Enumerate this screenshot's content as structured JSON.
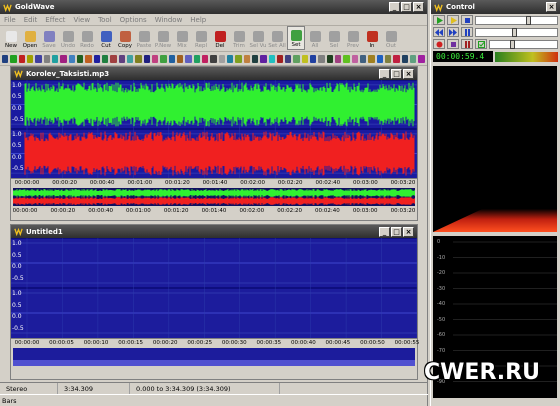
{
  "app": {
    "title": "GoldWave"
  },
  "menu": [
    "File",
    "Edit",
    "Effect",
    "View",
    "Tool",
    "Options",
    "Window",
    "Help"
  ],
  "toolbar": [
    {
      "label": "New",
      "color": "#e8e8e8",
      "on": true
    },
    {
      "label": "Open",
      "color": "#e0b040",
      "on": true
    },
    {
      "label": "Save",
      "color": "#8080c0",
      "on": false
    },
    {
      "label": "Undo",
      "color": "#a0a0a0",
      "on": false
    },
    {
      "label": "Redo",
      "color": "#a0a0a0",
      "on": false
    },
    {
      "label": "Cut",
      "color": "#4060c0",
      "on": true
    },
    {
      "label": "Copy",
      "color": "#c06040",
      "on": true
    },
    {
      "label": "Paste",
      "color": "#a0a0a0",
      "on": false
    },
    {
      "label": "P.New",
      "color": "#a0a0a0",
      "on": false
    },
    {
      "label": "Mix",
      "color": "#a0a0a0",
      "on": false
    },
    {
      "label": "Repl",
      "color": "#a0a0a0",
      "on": false
    },
    {
      "label": "Del",
      "color": "#c02020",
      "on": true
    },
    {
      "label": "Trim",
      "color": "#a0a0a0",
      "on": false
    },
    {
      "label": "Sel Vu",
      "color": "#a0a0a0",
      "on": false
    },
    {
      "label": "Set All",
      "color": "#a0a0a0",
      "on": false
    },
    {
      "label": "Set",
      "color": "#40a040",
      "on": true
    },
    {
      "label": "All",
      "color": "#a0a0a0",
      "on": false
    },
    {
      "label": "Sel",
      "color": "#a0a0a0",
      "on": false
    },
    {
      "label": "Prev",
      "color": "#a0a0a0",
      "on": false
    },
    {
      "label": "In",
      "color": "#c03020",
      "on": true
    },
    {
      "label": "Out",
      "color": "#a0a0a0",
      "on": false
    }
  ],
  "doc1": {
    "title": "Korolev_Taksisti.mp3",
    "yticks_top": [
      "1.0",
      "0.5",
      "0.0",
      "-0.5"
    ],
    "yticks_bot": [
      "1.0",
      "0.5",
      "0.0",
      "-0.5"
    ],
    "time_labels": [
      "00:00:00",
      "00:00:20",
      "00:00:40",
      "00:01:00",
      "00:01:20",
      "00:01:40",
      "00:02:00",
      "00:02:20",
      "00:02:40",
      "00:03:00",
      "00:03:20"
    ],
    "ov_labels": [
      "00:00:00",
      "00:00:20",
      "00:00:40",
      "00:01:00",
      "00:01:20",
      "00:01:40",
      "00:02:00",
      "00:02:20",
      "00:02:40",
      "00:03:00",
      "00:03:20"
    ]
  },
  "doc2": {
    "title": "Untitled1",
    "yticks_top": [
      "1.0",
      "0.5",
      "0.0",
      "-0.5"
    ],
    "yticks_bot": [
      "1.0",
      "0.5",
      "0.0",
      "-0.5"
    ],
    "time_labels": [
      "00:00:00",
      "00:00:05",
      "00:00:10",
      "00:00:15",
      "00:00:20",
      "00:00:25",
      "00:00:30",
      "00:00:35",
      "00:00:40",
      "00:00:45",
      "00:00:50",
      "00:00:55"
    ]
  },
  "status": {
    "channels": "Stereo",
    "length": "3:34.309",
    "selection": "0.000 to 3:34.309 (3:34.309)"
  },
  "bottom": {
    "label": "Bars"
  },
  "control": {
    "title": "Control",
    "counter": "00:00:59.4",
    "spectrum_labels": [
      "0",
      "-10",
      "-20",
      "-30",
      "-40",
      "-50",
      "-60",
      "-70",
      "-80",
      "-90"
    ]
  },
  "watermark": "CWER.RU"
}
